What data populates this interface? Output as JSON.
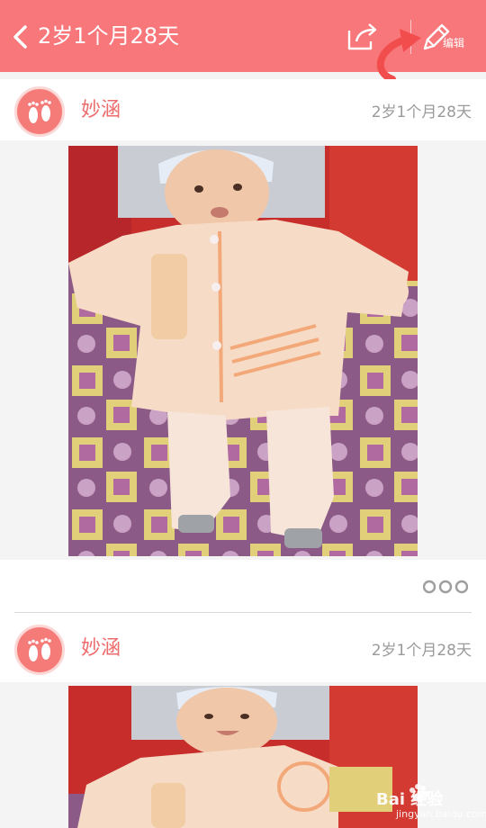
{
  "header": {
    "title": "2岁1个月28天",
    "edit_label": "编辑",
    "bg_color": "#f8777a",
    "icons": [
      "chevron-left-icon",
      "share-icon",
      "pencil-icon"
    ]
  },
  "posts": [
    {
      "author": "妙涵",
      "age": "2岁1个月28天"
    },
    {
      "author": "妙涵",
      "age": "2岁1个月28天"
    }
  ],
  "watermark": {
    "brand": "Bai 经验",
    "url": "jingyan.baidu.com"
  },
  "colors": {
    "accent": "#ee6b6c",
    "avatar": "#f47b78",
    "muted": "#9a9a9a"
  }
}
